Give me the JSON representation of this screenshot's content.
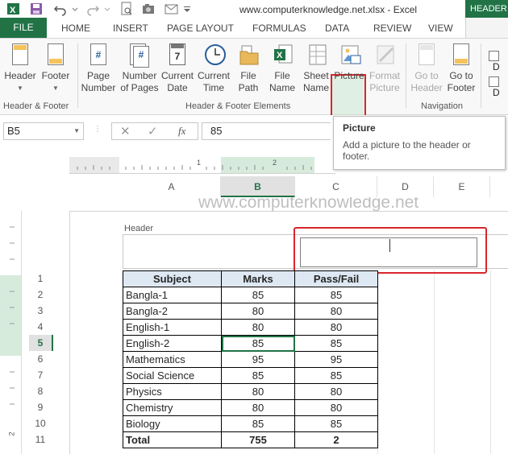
{
  "window": {
    "title": "www.computerknowledge.net.xlsx - Excel",
    "contextual_tab": "HEADER &"
  },
  "tabs": [
    "FILE",
    "HOME",
    "INSERT",
    "PAGE LAYOUT",
    "FORMULAS",
    "DATA",
    "REVIEW",
    "VIEW"
  ],
  "ribbon": {
    "header_label": "Header",
    "footer_label": "Footer",
    "page_number": [
      "Page",
      "Number"
    ],
    "number_of_pages": [
      "Number",
      "of Pages"
    ],
    "current_date": [
      "Current",
      "Date"
    ],
    "current_time": [
      "Current",
      "Time"
    ],
    "file_path": [
      "File",
      "Path"
    ],
    "file_name": [
      "File",
      "Name"
    ],
    "sheet_name": [
      "Sheet",
      "Name"
    ],
    "picture": "Picture",
    "format_picture": [
      "Format",
      "Picture"
    ],
    "go_to_header": [
      "Go to",
      "Header"
    ],
    "go_to_footer": [
      "Go to",
      "Footer"
    ],
    "page_number_glyph": "#",
    "number_of_pages_glyph": "#",
    "current_date_glyph": "7",
    "groups": {
      "header_footer": "Header & Footer",
      "elements": "Header & Footer Elements",
      "navigation": "Navigation"
    },
    "checkbox_1": "D",
    "checkbox_2": "D"
  },
  "formula_bar": {
    "name_box": "B5",
    "fx": "fx",
    "value": "85"
  },
  "tooltip": {
    "title": "Picture",
    "body": "Add a picture to the header or footer."
  },
  "ruler": {
    "ticks": [
      "1",
      "2"
    ]
  },
  "columns": [
    "A",
    "B",
    "C",
    "D",
    "E"
  ],
  "watermark": "www.computerknowledge.net",
  "sheet": {
    "header_label": "Header",
    "rows": [
      {
        "n": "1",
        "subject": "Subject",
        "marks": "Marks",
        "pf": "Pass/Fail"
      },
      {
        "n": "2",
        "subject": "Bangla-1",
        "marks": "85",
        "pf": "85"
      },
      {
        "n": "3",
        "subject": "Bangla-2",
        "marks": "80",
        "pf": "80"
      },
      {
        "n": "4",
        "subject": "English-1",
        "marks": "80",
        "pf": "80"
      },
      {
        "n": "5",
        "subject": "English-2",
        "marks": "85",
        "pf": "85"
      },
      {
        "n": "6",
        "subject": "Mathematics",
        "marks": "95",
        "pf": "95"
      },
      {
        "n": "7",
        "subject": "Social Science",
        "marks": "85",
        "pf": "85"
      },
      {
        "n": "8",
        "subject": "Physics",
        "marks": "80",
        "pf": "80"
      },
      {
        "n": "9",
        "subject": "Chemistry",
        "marks": "80",
        "pf": "80"
      },
      {
        "n": "10",
        "subject": "Biology",
        "marks": "85",
        "pf": "85"
      },
      {
        "n": "11",
        "subject": "Total",
        "marks": "755",
        "pf": "2"
      }
    ],
    "left_ruler_mark": "2"
  },
  "colors": {
    "accent": "#217346",
    "highlight": "#d9262c"
  }
}
